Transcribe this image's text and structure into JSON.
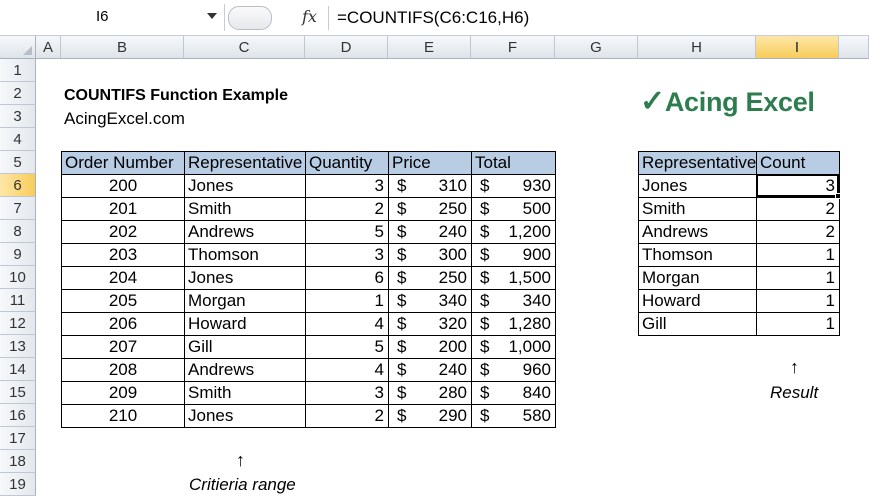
{
  "formula_bar": {
    "name_box": "I6",
    "fx_label": "fx",
    "formula": "=COUNTIFS(C6:C16,H6)"
  },
  "columns": [
    "A",
    "B",
    "C",
    "D",
    "E",
    "F",
    "G",
    "H",
    "I"
  ],
  "rows": [
    "1",
    "2",
    "3",
    "4",
    "5",
    "6",
    "7",
    "8",
    "9",
    "10",
    "11",
    "12",
    "13",
    "14",
    "15",
    "16",
    "17",
    "18",
    "19"
  ],
  "title": "COUNTIFS Function Example",
  "site": "AcingExcel.com",
  "logo": {
    "check": "✓",
    "text": "Acing Excel",
    "color": "#2e7d4f"
  },
  "orders": {
    "headers": [
      "Order Number",
      "Representative",
      "Quantity",
      "Price",
      "Total"
    ],
    "currency": "$",
    "rows": [
      {
        "order": "200",
        "rep": "Jones",
        "qty": "3",
        "price": "310",
        "total": "930"
      },
      {
        "order": "201",
        "rep": "Smith",
        "qty": "2",
        "price": "250",
        "total": "500"
      },
      {
        "order": "202",
        "rep": "Andrews",
        "qty": "5",
        "price": "240",
        "total": "1,200"
      },
      {
        "order": "203",
        "rep": "Thomson",
        "qty": "3",
        "price": "300",
        "total": "900"
      },
      {
        "order": "204",
        "rep": "Jones",
        "qty": "6",
        "price": "250",
        "total": "1,500"
      },
      {
        "order": "205",
        "rep": "Morgan",
        "qty": "1",
        "price": "340",
        "total": "340"
      },
      {
        "order": "206",
        "rep": "Howard",
        "qty": "4",
        "price": "320",
        "total": "1,280"
      },
      {
        "order": "207",
        "rep": "Gill",
        "qty": "5",
        "price": "200",
        "total": "1,000"
      },
      {
        "order": "208",
        "rep": "Andrews",
        "qty": "4",
        "price": "240",
        "total": "960"
      },
      {
        "order": "209",
        "rep": "Smith",
        "qty": "3",
        "price": "280",
        "total": "840"
      },
      {
        "order": "210",
        "rep": "Jones",
        "qty": "2",
        "price": "290",
        "total": "580"
      }
    ]
  },
  "counts": {
    "headers": [
      "Representative",
      "Count"
    ],
    "rows": [
      {
        "rep": "Jones",
        "count": "3"
      },
      {
        "rep": "Smith",
        "count": "2"
      },
      {
        "rep": "Andrews",
        "count": "2"
      },
      {
        "rep": "Thomson",
        "count": "1"
      },
      {
        "rep": "Morgan",
        "count": "1"
      },
      {
        "rep": "Howard",
        "count": "1"
      },
      {
        "rep": "Gill",
        "count": "1"
      }
    ]
  },
  "annotations": {
    "arrow": "↑",
    "criteria_label": "Critieria range",
    "result_label": "Result"
  },
  "colors": {
    "header_fill": "#b8cce4",
    "selected_header": "#f8cc5a"
  }
}
